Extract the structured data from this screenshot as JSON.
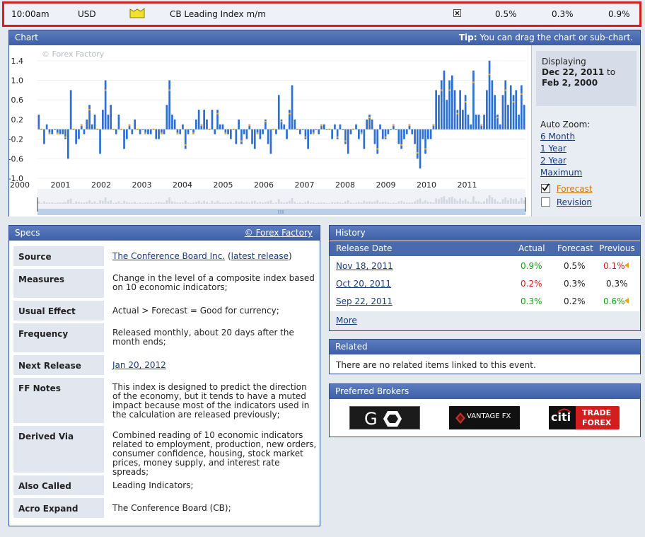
{
  "event": {
    "time": "10:00am",
    "currency": "USD",
    "impact_icon": "impact-folder-icon",
    "name": "CB Leading Index m/m",
    "detail_icon": "close-detail-icon",
    "actual": "0.5%",
    "forecast": "0.3%",
    "previous": "0.9%"
  },
  "chart_panel": {
    "title": "Chart",
    "tip_bold": "Tip:",
    "tip_text": " You can drag the chart or sub-chart.",
    "watermark": "© Forex Factory",
    "displaying_label": "Displaying",
    "range_start": "Dec 22, 2011",
    "range_to": " to",
    "range_end": "Feb 2, 2000",
    "auto_zoom_label": "Auto Zoom:",
    "zoom_options": [
      "6 Month",
      "1 Year",
      "2 Year",
      "Maximum"
    ],
    "forecast_label": "Forecast",
    "revision_label": "Revision",
    "forecast_checked": true,
    "revision_checked": false
  },
  "chart_data": {
    "type": "bar",
    "y_ticks": [
      "1.4",
      "1.0",
      "0.6",
      "0.2",
      "-0.2",
      "-0.6",
      "-1.0"
    ],
    "x_ticks": [
      "2000",
      "2001",
      "2002",
      "2003",
      "2004",
      "2005",
      "2006",
      "2007",
      "2008",
      "2009",
      "2010",
      "2011"
    ],
    "ylim": [
      -1.0,
      1.6
    ],
    "colors": {
      "bar": "#2f6fd0",
      "forecast": "#f2a81c"
    },
    "series": [
      {
        "values": [
          0.3,
          0.0,
          -0.3,
          0.1,
          -0.1,
          -0.1,
          0.0,
          -0.1,
          -0.1,
          -0.1,
          -0.2,
          -0.6,
          0.8,
          0.0,
          -0.3,
          -0.2,
          0.1,
          -0.1,
          0.2,
          0.5,
          0.1,
          0.3,
          0.0,
          -0.5,
          0.4,
          1.0,
          0.3,
          0.5,
          0.0,
          -0.1,
          0.3,
          0.0,
          -0.4,
          -0.2,
          0.1,
          -0.1,
          0.2,
          0.0,
          -0.1,
          0.0,
          -0.1,
          -0.1,
          -0.1,
          0.0,
          -0.2,
          -0.2,
          -0.1,
          -0.1,
          0.5,
          1.0,
          0.3,
          0.2,
          -0.1,
          -0.1,
          0.1,
          -0.4,
          -0.1,
          0.0,
          -0.1,
          0.2,
          0.4,
          0.1,
          0.4,
          0.2,
          0.0,
          0.4,
          -0.1,
          0.4,
          0.1,
          0.1,
          -0.1,
          -0.1,
          -0.2,
          0.0,
          -0.3,
          0.2,
          -0.3,
          -0.1,
          -0.2,
          0.1,
          -0.3,
          -0.4,
          -0.1,
          -0.2,
          -0.1,
          0.2,
          -0.3,
          -0.5,
          0.0,
          -0.1,
          0.7,
          0.2,
          0.1,
          -0.2,
          0.4,
          0.9,
          0.2,
          0.0,
          -0.1,
          0.0,
          -0.2,
          -0.4,
          -0.1,
          -0.1,
          0.0,
          -0.1,
          0.1,
          0.1,
          0.0,
          0.0,
          -0.2,
          0.1,
          -0.2,
          0.1,
          0.0,
          -0.3,
          -0.5,
          -0.1,
          0.0,
          0.1,
          -0.2,
          -0.1,
          -0.4,
          0.2,
          0.3,
          0.2,
          -0.3,
          -0.5,
          0.1,
          -0.2,
          -0.2,
          -0.1,
          0.0,
          0.1,
          0.0,
          -0.3,
          -0.4,
          -0.2,
          -0.1,
          0.1,
          -0.1,
          -0.3,
          -0.6,
          -0.8,
          -0.2,
          -0.5,
          -0.2,
          -0.2,
          0.1,
          0.8,
          0.7,
          1.0,
          1.2,
          0.6,
          1.0,
          1.1,
          0.8,
          0.4,
          0.8,
          0.4,
          0.7,
          0.3,
          0.1,
          1.2,
          0.3,
          0.3,
          0.1,
          0.3,
          0.8,
          1.4,
          1.0,
          0.7,
          0.3,
          0.1,
          0.7,
          1.0,
          0.5,
          0.9,
          0.7,
          0.8,
          0.3,
          0.9,
          0.5
        ]
      }
    ]
  },
  "specs": {
    "title": "Specs",
    "copyright": "© Forex Factory",
    "rows": [
      {
        "key": "Source",
        "value": "The Conference Board Inc.",
        "extra_prefix": " (",
        "extra_link": "latest release",
        "extra_suffix": ")"
      },
      {
        "key": "Measures",
        "value": "Change in the level of a composite index based on 10 economic indicators;"
      },
      {
        "key": "Usual Effect",
        "value": "Actual > Forecast = Good for currency;"
      },
      {
        "key": "Frequency",
        "value": "Released monthly, about 20 days after the month ends;"
      },
      {
        "key": "Next Release",
        "value": "Jan 20, 2012"
      },
      {
        "key": "FF Notes",
        "value": "This index is designed to predict the direction of the economy, but it tends to have a muted impact because most of the indicators used in the calculation are released previously;"
      },
      {
        "key": "Derived Via",
        "value": "Combined reading of 10 economic indicators related to employment, production, new orders, consumer confidence, housing, stock market prices, money supply, and interest rate spreads;"
      },
      {
        "key": "Also Called",
        "value": "Leading Indicators;"
      },
      {
        "key": "Acro Expand",
        "value": "The Conference Board (CB);"
      }
    ]
  },
  "history": {
    "title": "History",
    "columns": [
      "Release Date",
      "Actual",
      "Forecast",
      "Previous"
    ],
    "rows": [
      {
        "date": "Nov 18, 2011",
        "actual": "0.9%",
        "forecast": "0.5%",
        "previous": "0.1%"
      },
      {
        "date": "Oct 20, 2011",
        "actual": "0.2%",
        "forecast": "0.3%",
        "previous": "0.3%"
      },
      {
        "date": "Sep 22, 2011",
        "actual": "0.3%",
        "forecast": "0.2%",
        "previous": "0.6%"
      }
    ],
    "more_label": "More"
  },
  "related": {
    "title": "Related",
    "text": "There are no related items linked to this event."
  },
  "brokers": {
    "title": "Preferred Brokers",
    "logos": [
      {
        "name": "GO",
        "letter1": "G"
      },
      {
        "name": "VANTAGE FX",
        "label": "VANTAGE FX"
      },
      {
        "name": "citi TRADE FOREX",
        "citi": "citi",
        "line1": "TRADE",
        "line2": "FOREX"
      }
    ]
  }
}
